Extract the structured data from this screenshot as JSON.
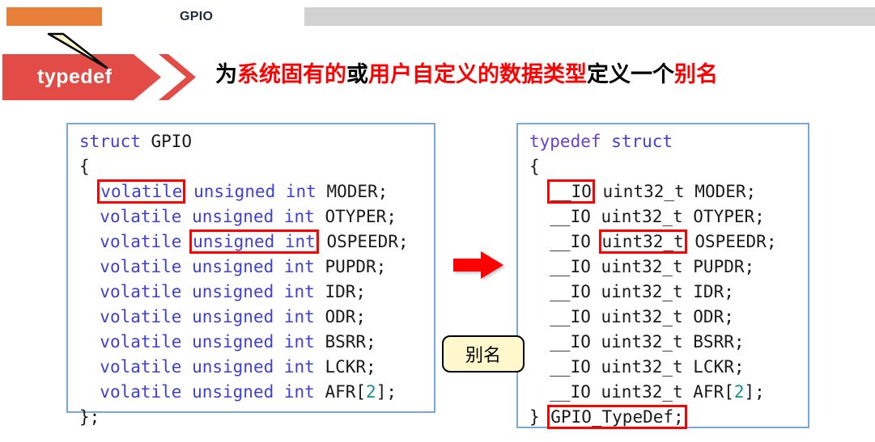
{
  "header": {
    "title": "GPIO",
    "orange_bar_color": "#E8803A",
    "gray_bar_color": "#D2D2D2"
  },
  "banner": {
    "badge_label": "typedef",
    "badge_color": "#E24B46",
    "highlight_color": "#FF0000",
    "title_segments": [
      {
        "text": "为",
        "highlight": false
      },
      {
        "text": "系统固有的",
        "highlight": true
      },
      {
        "text": "或",
        "highlight": false
      },
      {
        "text": "用户自定义的数据类型",
        "highlight": true
      },
      {
        "text": "定义一个",
        "highlight": false
      },
      {
        "text": "别名",
        "highlight": true
      }
    ],
    "title_plain": "为系统固有的或用户自定义的数据类型定义一个别名"
  },
  "code_left": {
    "border_color": "#7BA7D7",
    "lines": [
      [
        {
          "t": "struct",
          "c": "kw"
        },
        {
          "t": " GPIO",
          "c": ""
        }
      ],
      [
        {
          "t": "{",
          "c": ""
        }
      ],
      [
        {
          "t": "  ",
          "c": ""
        },
        {
          "t": "volatile",
          "c": "kw",
          "box": true
        },
        {
          "t": " ",
          "c": ""
        },
        {
          "t": "unsigned int",
          "c": "kw"
        },
        {
          "t": " MODER;",
          "c": ""
        }
      ],
      [
        {
          "t": "  ",
          "c": ""
        },
        {
          "t": "volatile unsigned int",
          "c": "kw"
        },
        {
          "t": " OTYPER;",
          "c": ""
        }
      ],
      [
        {
          "t": "  ",
          "c": ""
        },
        {
          "t": "volatile",
          "c": "kw"
        },
        {
          "t": " ",
          "c": ""
        },
        {
          "t": "unsigned int",
          "c": "kw",
          "box": true
        },
        {
          "t": " OSPEEDR;",
          "c": ""
        }
      ],
      [
        {
          "t": "  ",
          "c": ""
        },
        {
          "t": "volatile unsigned int",
          "c": "kw"
        },
        {
          "t": " PUPDR;",
          "c": ""
        }
      ],
      [
        {
          "t": "  ",
          "c": ""
        },
        {
          "t": "volatile unsigned int",
          "c": "kw"
        },
        {
          "t": " IDR;",
          "c": ""
        }
      ],
      [
        {
          "t": "  ",
          "c": ""
        },
        {
          "t": "volatile unsigned int",
          "c": "kw"
        },
        {
          "t": " ODR;",
          "c": ""
        }
      ],
      [
        {
          "t": "  ",
          "c": ""
        },
        {
          "t": "volatile unsigned int",
          "c": "kw"
        },
        {
          "t": " BSRR;",
          "c": ""
        }
      ],
      [
        {
          "t": "  ",
          "c": ""
        },
        {
          "t": "volatile unsigned int",
          "c": "kw"
        },
        {
          "t": " LCKR;",
          "c": ""
        }
      ],
      [
        {
          "t": "  ",
          "c": ""
        },
        {
          "t": "volatile unsigned int",
          "c": "kw"
        },
        {
          "t": " AFR[",
          "c": ""
        },
        {
          "t": "2",
          "c": "num"
        },
        {
          "t": "];",
          "c": ""
        }
      ],
      [
        {
          "t": "};",
          "c": ""
        }
      ]
    ]
  },
  "code_right": {
    "border_color": "#7BA7D7",
    "lines": [
      [
        {
          "t": "typedef",
          "c": "kw2"
        },
        {
          "t": " ",
          "c": ""
        },
        {
          "t": "struct",
          "c": "kw"
        }
      ],
      [
        {
          "t": "{",
          "c": ""
        }
      ],
      [
        {
          "t": "  ",
          "c": ""
        },
        {
          "t": "__IO",
          "c": "",
          "box": true
        },
        {
          "t": " uint32_t MODER;",
          "c": ""
        }
      ],
      [
        {
          "t": "  __IO uint32_t OTYPER;",
          "c": ""
        }
      ],
      [
        {
          "t": "  __IO ",
          "c": ""
        },
        {
          "t": "uint32_t",
          "c": "",
          "box": true
        },
        {
          "t": " OSPEEDR;",
          "c": ""
        }
      ],
      [
        {
          "t": "  __IO uint32_t PUPDR;",
          "c": ""
        }
      ],
      [
        {
          "t": "  __IO uint32_t IDR;",
          "c": ""
        }
      ],
      [
        {
          "t": "  __IO uint32_t ODR;",
          "c": ""
        }
      ],
      [
        {
          "t": "  __IO uint32_t BSRR;",
          "c": ""
        }
      ],
      [
        {
          "t": "  __IO uint32_t LCKR;",
          "c": ""
        }
      ],
      [
        {
          "t": "  __IO uint32_t AFR[",
          "c": ""
        },
        {
          "t": "2",
          "c": "num"
        },
        {
          "t": "];",
          "c": ""
        }
      ],
      [
        {
          "t": "} ",
          "c": ""
        },
        {
          "t": "GPIO_TypeDef;",
          "c": "",
          "box": true
        }
      ]
    ]
  },
  "callout": {
    "label": "别名",
    "fill_color": "#FEF8CC",
    "border_color": "#000000"
  },
  "transform_arrow": {
    "direction": "right",
    "color": "#FF0000"
  }
}
